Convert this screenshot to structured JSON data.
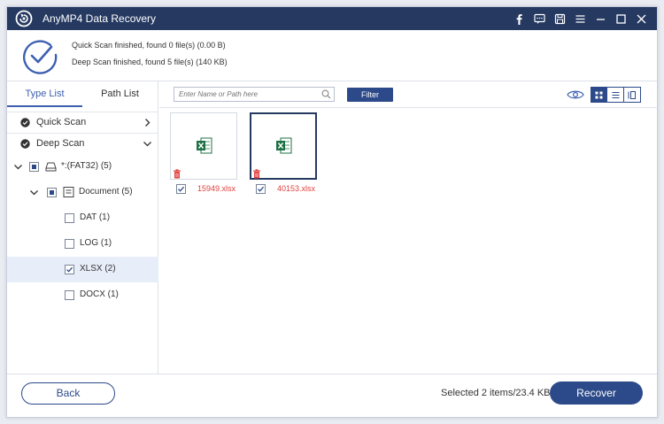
{
  "window": {
    "title": "AnyMP4 Data Recovery"
  },
  "titlebar_icons": [
    "facebook-icon",
    "feedback-icon",
    "save-icon",
    "menu-icon",
    "minimize-icon",
    "maximize-icon",
    "close-icon"
  ],
  "header": {
    "quick_scan_status": "Quick Scan finished, found 0 file(s) (0.00  B)",
    "deep_scan_status": "Deep Scan finished, found 5 file(s) (140 KB)"
  },
  "sidebar": {
    "tabs": [
      {
        "label": "Type List",
        "active": true
      },
      {
        "label": "Path List",
        "active": false
      }
    ],
    "scan_modes": [
      {
        "label": "Quick Scan"
      },
      {
        "label": "Deep Scan"
      }
    ],
    "tree": {
      "drive": {
        "label": "*:(FAT32) (5)"
      },
      "folder": {
        "label": "Document (5)"
      },
      "types": [
        {
          "label": "DAT (1)",
          "checked": false
        },
        {
          "label": "LOG (1)",
          "checked": false
        },
        {
          "label": "XLSX (2)",
          "checked": true
        },
        {
          "label": "DOCX (1)",
          "checked": false
        }
      ]
    }
  },
  "toolbar": {
    "search_placeholder": "Enter Name or Path here",
    "filter_label": "Filter"
  },
  "files": [
    {
      "name": "15949.xlsx",
      "checked": true,
      "deleted": true,
      "selected": false
    },
    {
      "name": "40153.xlsx",
      "checked": true,
      "deleted": true,
      "selected": true
    }
  ],
  "footer": {
    "back_label": "Back",
    "selected_info": "Selected 2 items/23.4 KB",
    "recover_label": "Recover"
  },
  "colors": {
    "titlebar": "#253961",
    "accent": "#2c4a8a",
    "deleted_name": "#e0413f",
    "excel_green": "#1e7145"
  }
}
